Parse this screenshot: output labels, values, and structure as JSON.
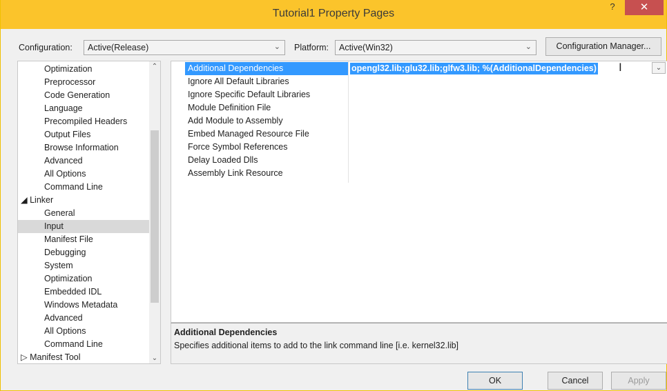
{
  "window": {
    "title": "Tutorial1 Property Pages",
    "help_glyph": "?",
    "close_glyph": "✕"
  },
  "config_bar": {
    "configuration_label": "Configuration:",
    "configuration_value": "Active(Release)",
    "platform_label": "Platform:",
    "platform_value": "Active(Win32)",
    "config_manager_label": "Configuration Manager..."
  },
  "tree": {
    "items": [
      {
        "label": "Optimization"
      },
      {
        "label": "Preprocessor"
      },
      {
        "label": "Code Generation"
      },
      {
        "label": "Language"
      },
      {
        "label": "Precompiled Headers"
      },
      {
        "label": "Output Files"
      },
      {
        "label": "Browse Information"
      },
      {
        "label": "Advanced"
      },
      {
        "label": "All Options"
      },
      {
        "label": "Command Line"
      },
      {
        "label": "◢ Linker"
      },
      {
        "label": "General"
      },
      {
        "label": "Input"
      },
      {
        "label": "Manifest File"
      },
      {
        "label": "Debugging"
      },
      {
        "label": "System"
      },
      {
        "label": "Optimization"
      },
      {
        "label": "Embedded IDL"
      },
      {
        "label": "Windows Metadata"
      },
      {
        "label": "Advanced"
      },
      {
        "label": "All Options"
      },
      {
        "label": "Command Line"
      },
      {
        "label": "▷ Manifest Tool"
      }
    ],
    "selected": "Input"
  },
  "properties": {
    "rows": [
      {
        "name": "Additional Dependencies",
        "value": "opengl32.lib;glu32.lib;glfw3.lib; %(AdditionalDependencies)"
      },
      {
        "name": "Ignore All Default Libraries",
        "value": ""
      },
      {
        "name": "Ignore Specific Default Libraries",
        "value": ""
      },
      {
        "name": "Module Definition File",
        "value": ""
      },
      {
        "name": "Add Module to Assembly",
        "value": ""
      },
      {
        "name": "Embed Managed Resource File",
        "value": ""
      },
      {
        "name": "Force Symbol References",
        "value": ""
      },
      {
        "name": "Delay Loaded Dlls",
        "value": ""
      },
      {
        "name": "Assembly Link Resource",
        "value": ""
      }
    ]
  },
  "description": {
    "title": "Additional Dependencies",
    "text": "Specifies additional items to add to the link command line [i.e. kernel32.lib]"
  },
  "buttons": {
    "ok": "OK",
    "cancel": "Cancel",
    "apply": "Apply"
  },
  "colors": {
    "titlebar": "#fbc42b",
    "selection": "#3399ff",
    "close": "#c75050"
  }
}
